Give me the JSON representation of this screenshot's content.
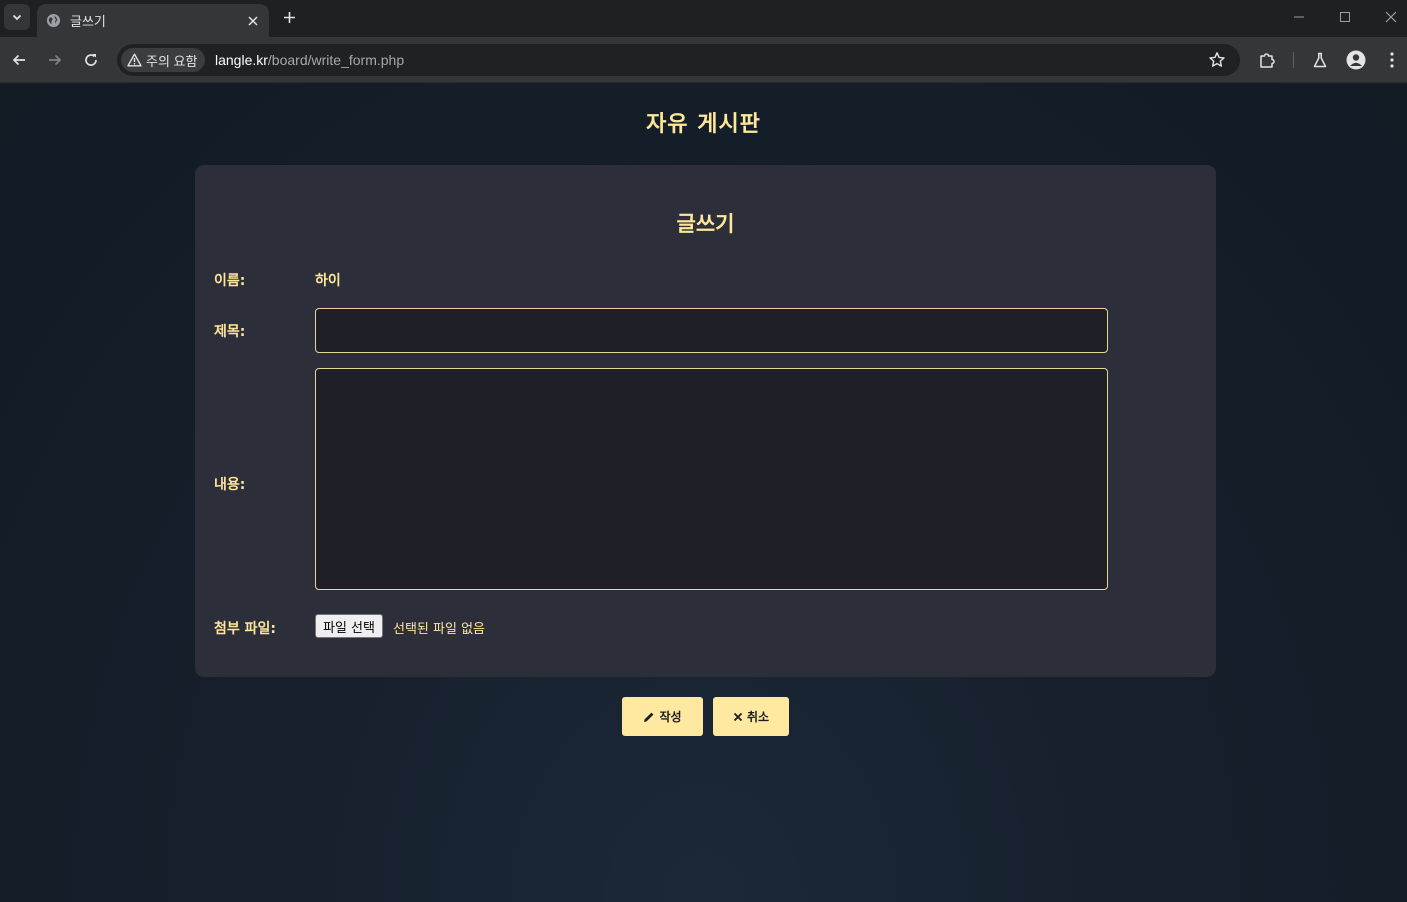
{
  "browser": {
    "tab_title": "글쓰기",
    "security_chip": "주의 요함",
    "url_host": "langle.kr",
    "url_path": "/board/write_form.php"
  },
  "page": {
    "heading": "자유 게시판",
    "form": {
      "title": "글쓰기",
      "name_label": "이름:",
      "name_value": "하이",
      "subject_label": "제목:",
      "subject_value": "",
      "content_label": "내용:",
      "content_value": "",
      "attachment_label": "첨부 파일:",
      "file_button_label": "파일 선택",
      "file_status": "선택된 파일 없음"
    },
    "buttons": {
      "submit_label": "작성",
      "cancel_label": "취소"
    }
  },
  "colors": {
    "accent": "#ffe69a",
    "card": "#2c2e3a",
    "input_bg": "#1f1f27"
  }
}
